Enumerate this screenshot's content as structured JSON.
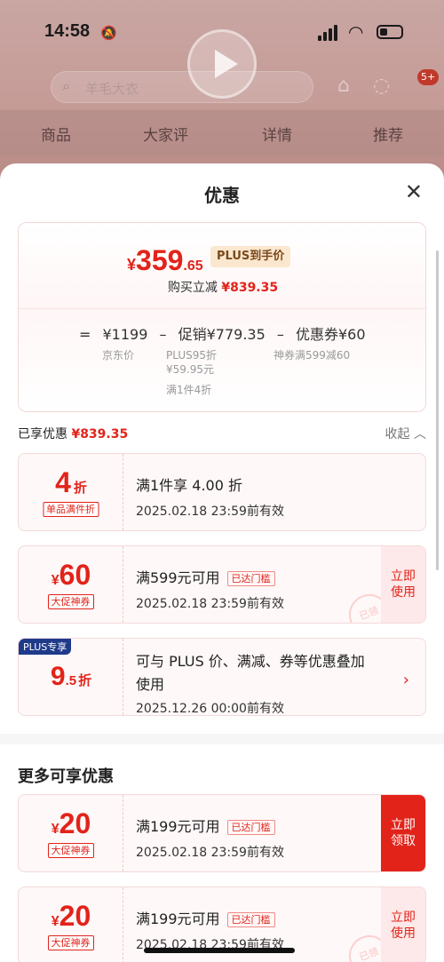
{
  "status_bar": {
    "time": "14:58"
  },
  "background_page": {
    "search_placeholder": "羊毛大衣",
    "cart_badge": "5+",
    "tabs": [
      "商品",
      "大家评",
      "详情",
      "推荐"
    ]
  },
  "sheet": {
    "title": "优惠",
    "close_label": "✕",
    "summary": {
      "currency": "¥",
      "price_int": "359",
      "price_dec": ".65",
      "plus_tag": "PLUS到手价",
      "reduce_label": "购买立减",
      "reduce_amount": "¥839.35",
      "formula": {
        "eq": "=",
        "jd_price": "¥1199",
        "minus1": "–",
        "promo": "促销¥779.35",
        "minus2": "–",
        "coupon": "优惠券¥60"
      },
      "jd_price_label": "京东价",
      "plus_discount_line1": "PLUS95折",
      "plus_discount_line2": "¥59.95元",
      "piece_discount": "满1件4折",
      "coupon_desc": "神券满599减60"
    },
    "enjoyed": {
      "label": "已享优惠",
      "amount": "¥839.35",
      "collapse": "收起 ︿"
    },
    "coupons": [
      {
        "big_int": "4",
        "big_unit": "折",
        "tag": "单品满件折",
        "line1": "满1件享 4.00 折",
        "line2": "2025.02.18 23:59前有效"
      },
      {
        "big_prefix": "¥",
        "big_int": "60",
        "tag": "大促神券",
        "line1": "满599元可用",
        "reached": "已达门槛",
        "line2": "2025.02.18 23:59前有效",
        "action": "立即\n使用",
        "stamp": "已领"
      },
      {
        "plus_label": "PLUS专享",
        "big_int": "9",
        "big_dec": ".5",
        "big_unit": "折",
        "line1a": "可与 PLUS 价、满减、券等优惠叠加",
        "line1b": "使用",
        "line2": "2025.12.26 00:00前有效",
        "chevron": "›"
      }
    ],
    "more_title": "更多可享优惠",
    "more_coupons": [
      {
        "big_prefix": "¥",
        "big_int": "20",
        "tag": "大促神券",
        "line1": "满199元可用",
        "reached": "已达门槛",
        "line2": "2025.02.18 23:59前有效",
        "action": "立即\n领取"
      },
      {
        "big_prefix": "¥",
        "big_int": "20",
        "tag": "大促神券",
        "line1": "满199元可用",
        "reached": "已达门槛",
        "line2": "2025.02.18 23:59前有效",
        "action": "立即\n使用",
        "stamp": "已领"
      }
    ]
  },
  "colors": {
    "accent_red": "#e2231a",
    "plus_blue": "#1f3a8a",
    "plus_gold_bg": "#fbe7cf"
  }
}
